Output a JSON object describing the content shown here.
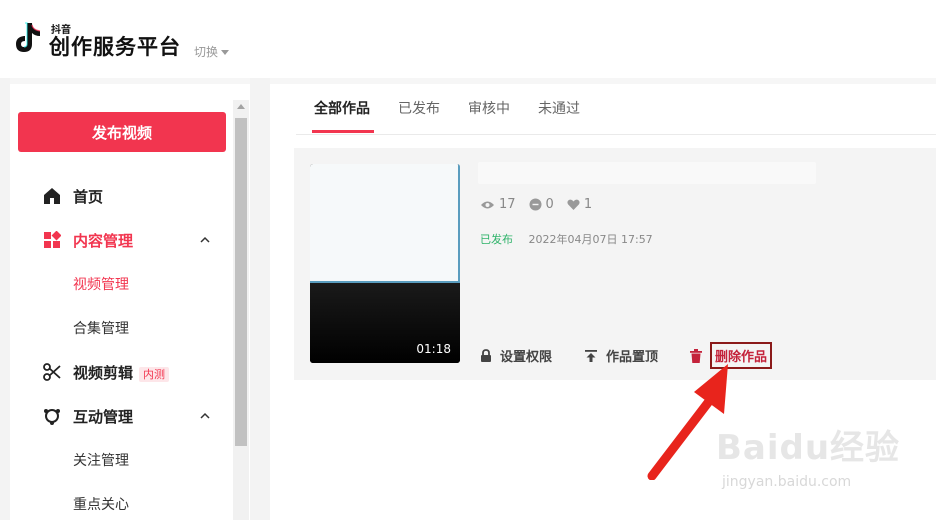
{
  "header": {
    "brand_small": "抖音",
    "brand_title": "创作服务平台",
    "switch_label": "切换"
  },
  "sidebar": {
    "publish_button": "发布视频",
    "items": [
      {
        "label": "首页",
        "icon": "home-icon"
      },
      {
        "label": "内容管理",
        "icon": "content-grid-icon",
        "expanded": true
      },
      {
        "label": "视频管理"
      },
      {
        "label": "合集管理"
      },
      {
        "label": "视频剪辑",
        "icon": "scissors-icon",
        "badge": "内测"
      },
      {
        "label": "互动管理",
        "icon": "interaction-icon",
        "expanded": true
      },
      {
        "label": "关注管理"
      },
      {
        "label": "重点关心"
      }
    ]
  },
  "tabs": [
    "全部作品",
    "已发布",
    "审核中",
    "未通过"
  ],
  "video": {
    "duration": "01:18",
    "views": "17",
    "comments": "0",
    "likes": "1",
    "status": "已发布",
    "time": "2022年04月07日 17:57",
    "actions": {
      "permission": "设置权限",
      "pin": "作品置顶",
      "delete": "删除作品"
    }
  },
  "watermark": {
    "main": "Baidu经验",
    "sub": "jingyan.baidu.com"
  },
  "colors": {
    "accent": "#f2354f",
    "published": "#2fb36a",
    "highlight_box": "#8b1a1a",
    "arrow": "#e8241c"
  }
}
